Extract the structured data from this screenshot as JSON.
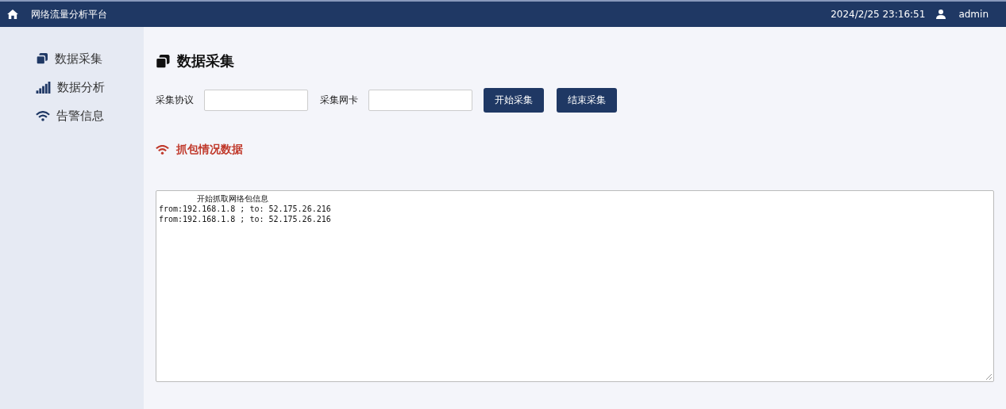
{
  "header": {
    "title": "网络流量分析平台",
    "datetime": "2024/2/25 23:16:51",
    "user": "admin"
  },
  "sidebar": {
    "items": [
      {
        "label": "数据采集"
      },
      {
        "label": "数据分析"
      },
      {
        "label": "告警信息"
      }
    ]
  },
  "page": {
    "title": "数据采集"
  },
  "form": {
    "fields": [
      {
        "label": "采集协议"
      },
      {
        "label": "采集网卡"
      }
    ],
    "buttons": [
      "开始采集",
      "结束采集"
    ]
  },
  "section": {
    "title": "抓包情况数据"
  },
  "log": {
    "lines": [
      {
        "kind": "heading",
        "text": "开始抓取网络包信息"
      },
      {
        "kind": "entry",
        "text": "from:192.168.1.8 ; to: 52.175.26.216"
      },
      {
        "kind": "entry",
        "text": "from:192.168.1.8 ; to: 52.175.26.216"
      }
    ]
  }
}
